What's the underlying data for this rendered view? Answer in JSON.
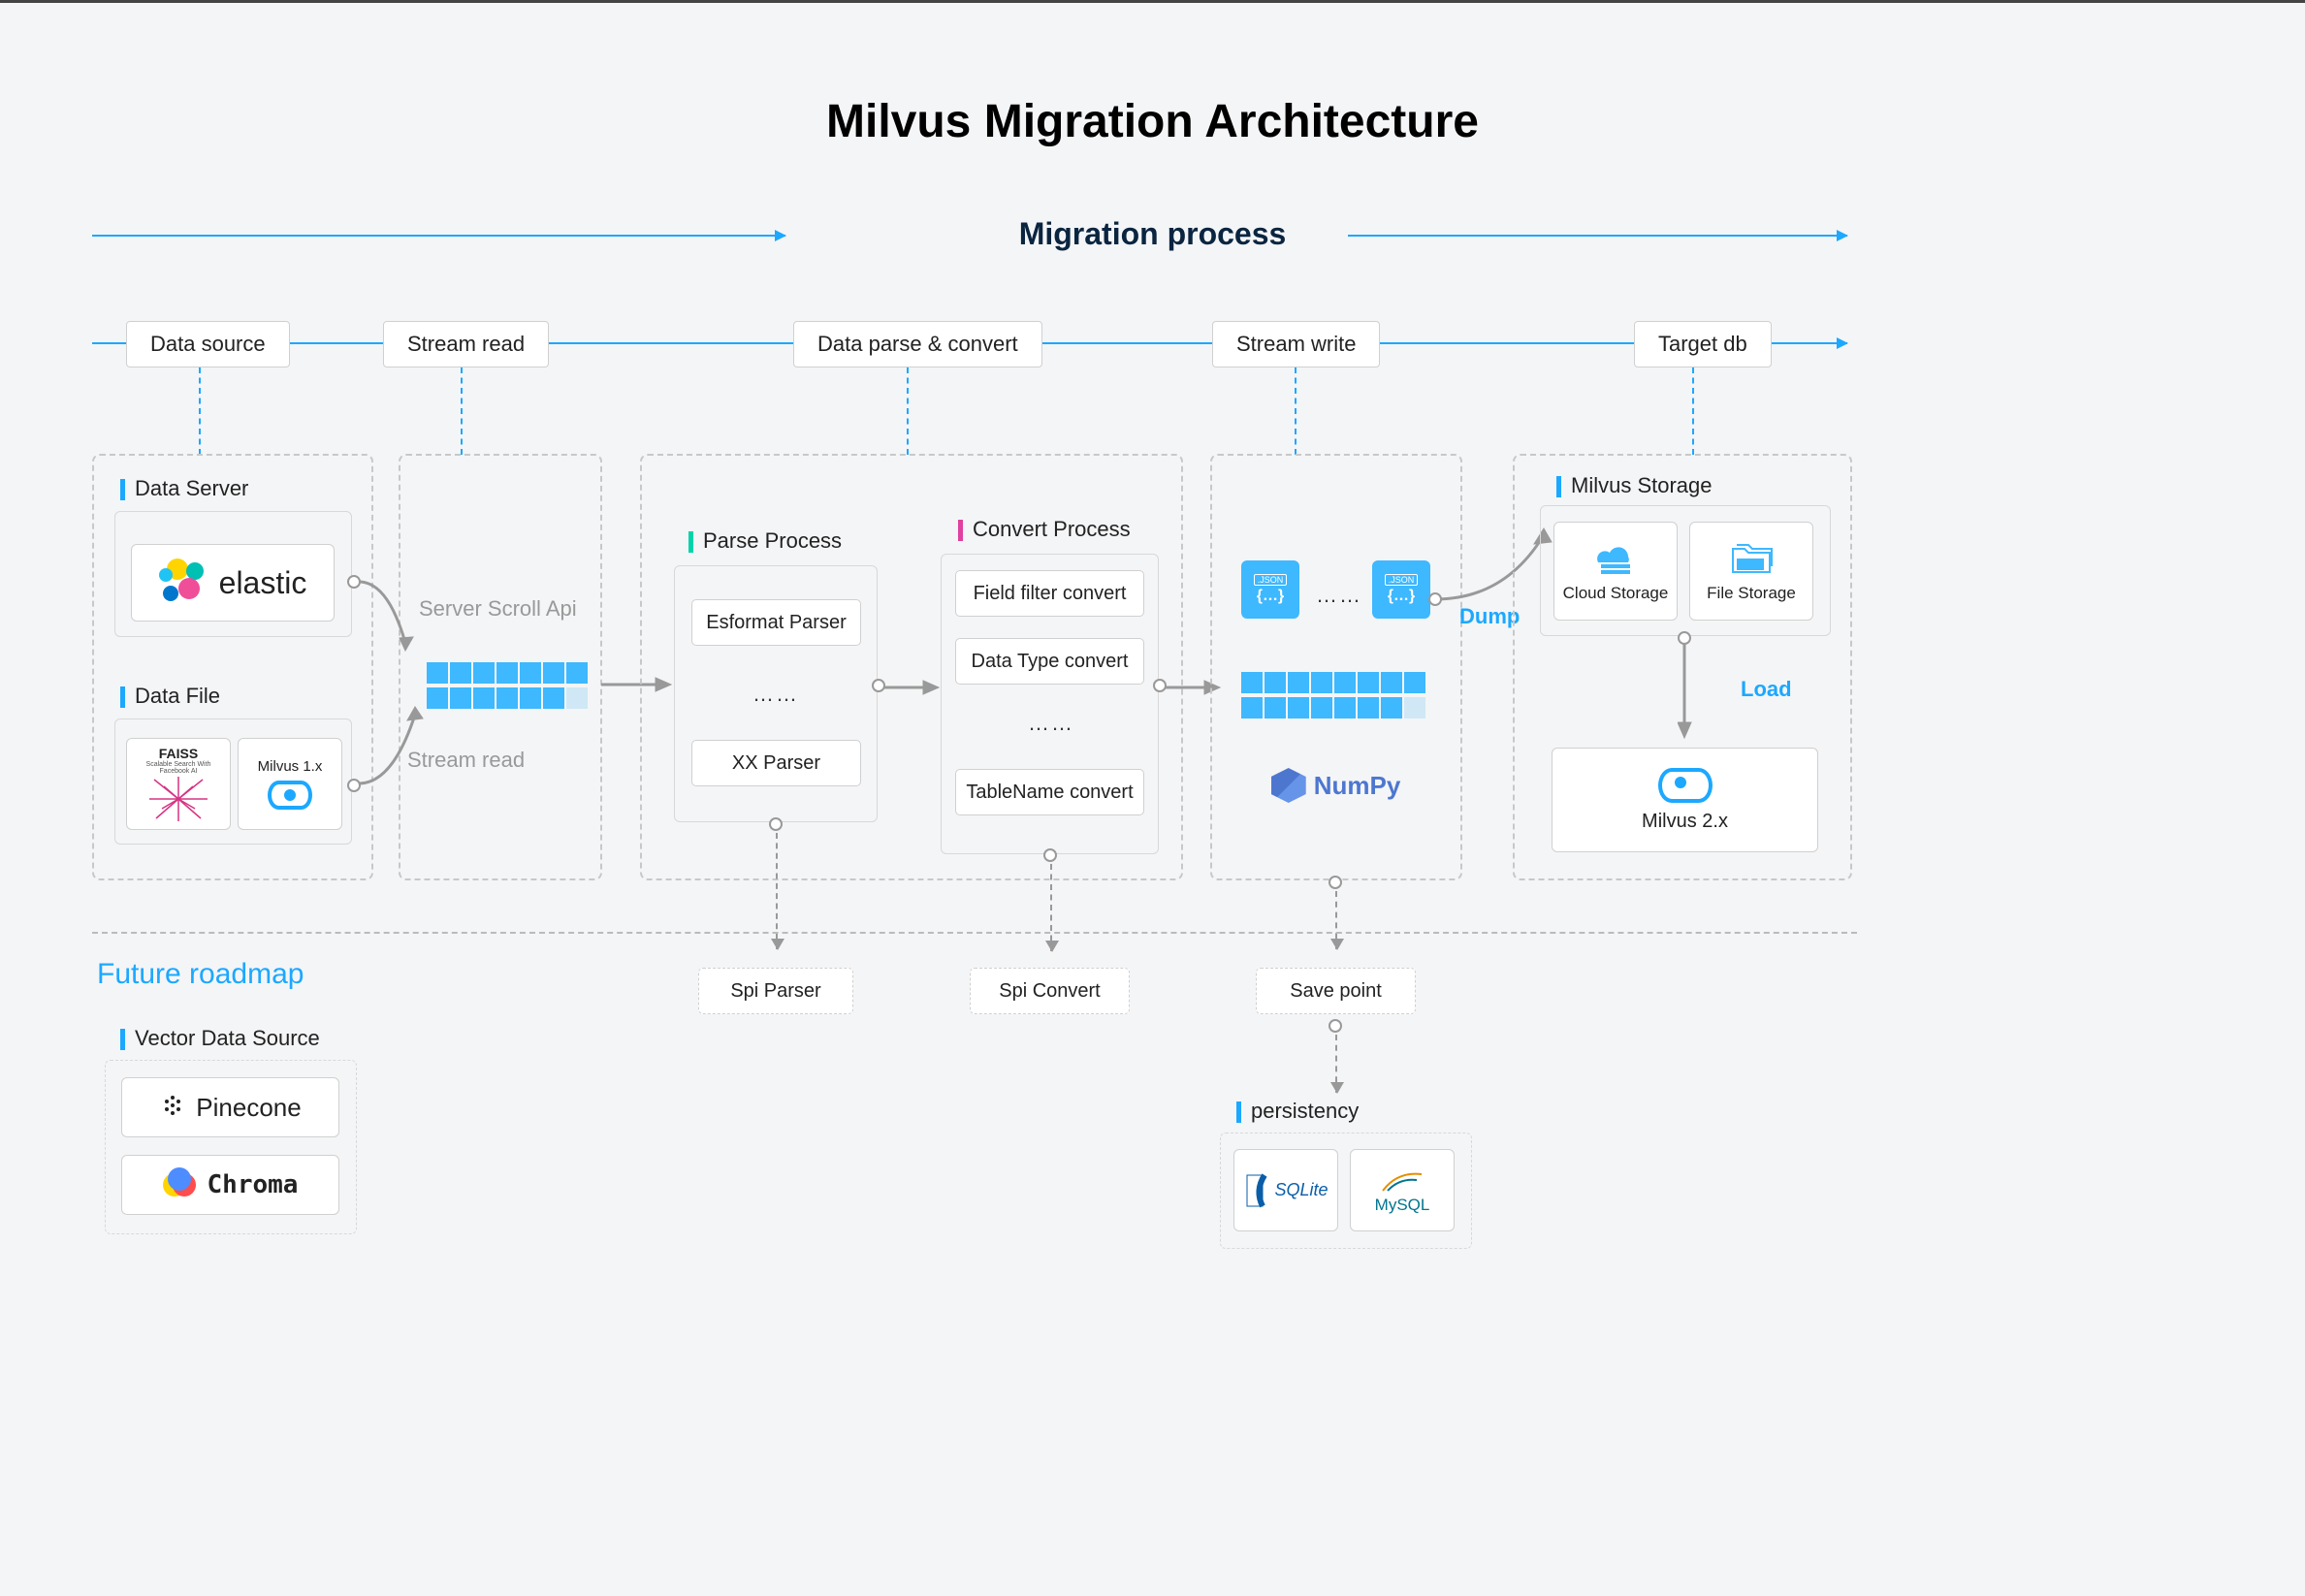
{
  "title": "Milvus Migration Architecture",
  "subtitle": "Migration process",
  "stages": {
    "source": "Data source",
    "read": "Stream read",
    "parse": "Data parse & convert",
    "write": "Stream write",
    "target": "Target db"
  },
  "sections": {
    "dataServer": "Data Server",
    "dataFile": "Data File",
    "parseProcess": "Parse Process",
    "convertProcess": "Convert Process",
    "milvusStorage": "Milvus Storage",
    "vectorDataSource": "Vector Data Source",
    "persistency": "persistency"
  },
  "labels": {
    "elastic": "elastic",
    "faissTitle": "FAISS",
    "faissSub": "Scalable Search With Facebook AI",
    "milvus1x": "Milvus 1.x",
    "milvus2x": "Milvus 2.x",
    "serverScrollApi": "Server Scroll Api",
    "streamRead": "Stream read",
    "esformatParser": "Esformat Parser",
    "xxParser": "XX Parser",
    "fieldFilterConvert": "Field filter convert",
    "dataTypeConvert": "Data Type convert",
    "tableNameConvert": "TableName convert",
    "numpy": "NumPy",
    "cloudStorage": "Cloud Storage",
    "fileStorage": "File Storage",
    "dump": "Dump",
    "load": "Load",
    "spiParser": "Spi Parser",
    "spiConvert": "Spi Convert",
    "savePoint": "Save point",
    "sqlite": "SQLite",
    "mysql": "MySQL",
    "pinecone": "Pinecone",
    "chroma": "Chroma",
    "json": ".JSON",
    "dotdot": "……"
  },
  "futureRoadmap": "Future roadmap"
}
